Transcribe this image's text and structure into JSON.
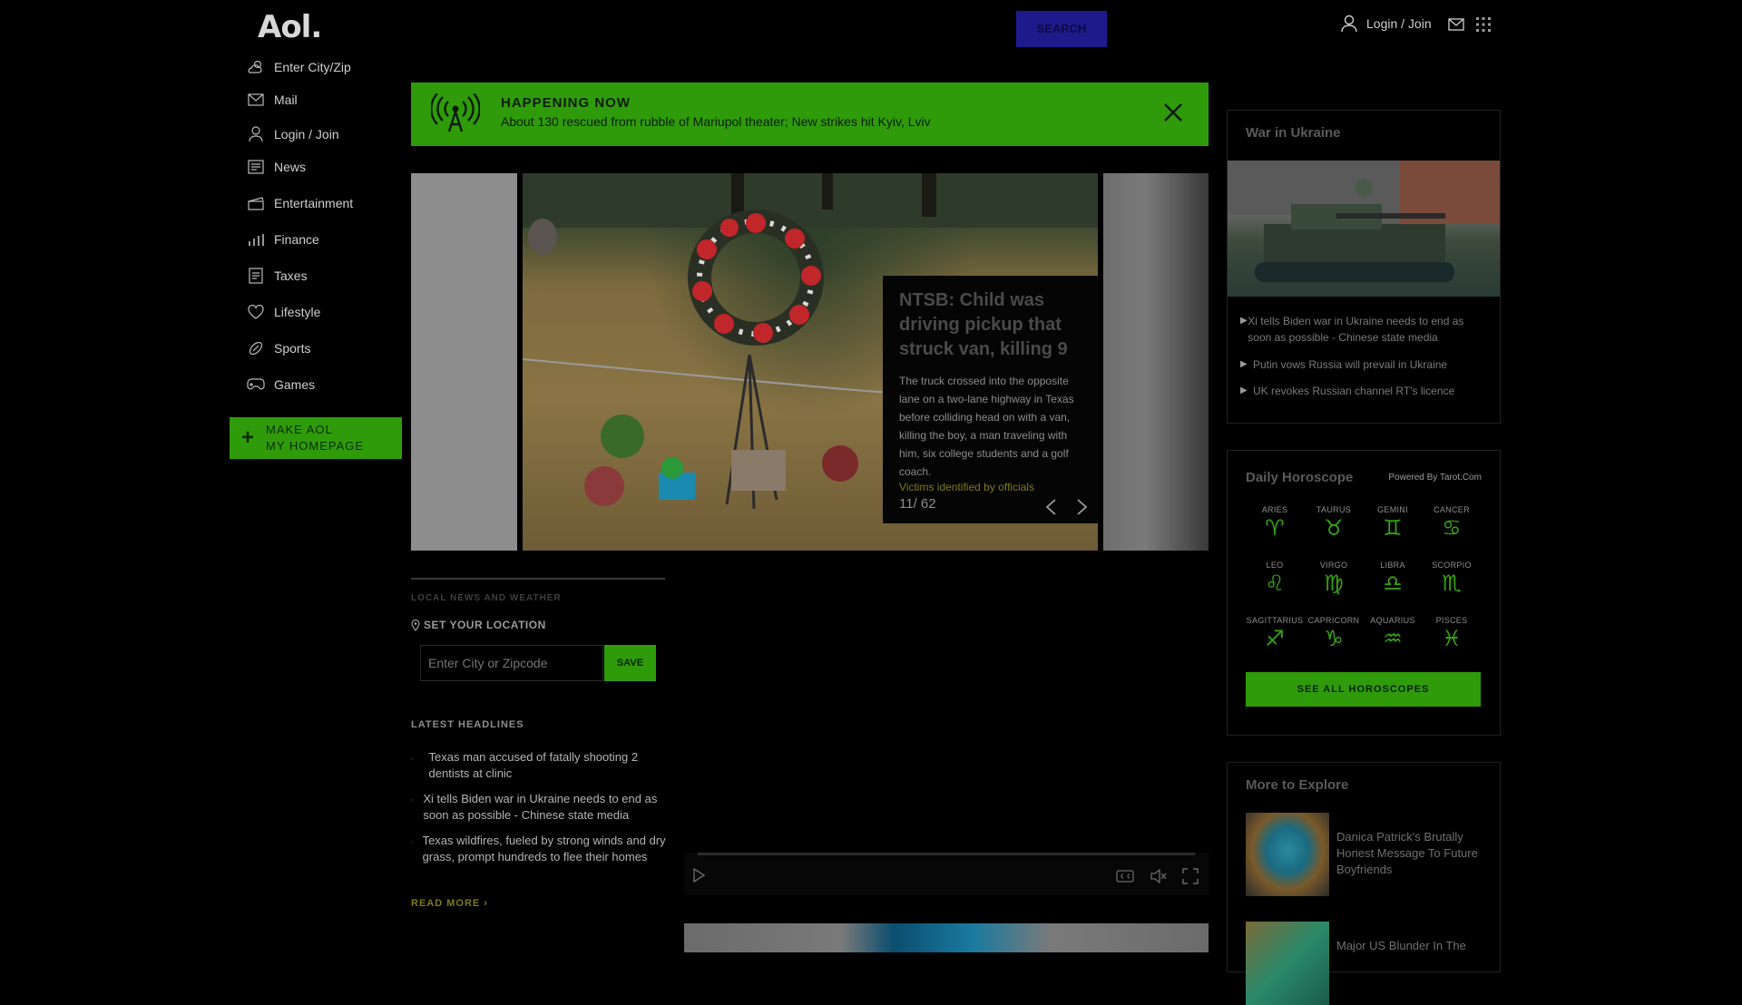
{
  "header": {
    "logo": "Aol.",
    "search_label": "SEARCH",
    "login_label": "Login / Join"
  },
  "sidebar": {
    "items": [
      {
        "label": "Enter City/Zip",
        "icon": "weather-icon"
      },
      {
        "label": "Mail",
        "icon": "mail-icon"
      },
      {
        "label": "Login / Join",
        "icon": "user-icon"
      },
      {
        "label": "News",
        "icon": "news-icon"
      },
      {
        "label": "Entertainment",
        "icon": "clapper-icon"
      },
      {
        "label": "Finance",
        "icon": "chart-icon"
      },
      {
        "label": "Taxes",
        "icon": "taxes-icon"
      },
      {
        "label": "Lifestyle",
        "icon": "heart-icon"
      },
      {
        "label": "Sports",
        "icon": "football-icon"
      },
      {
        "label": "Games",
        "icon": "gamepad-icon"
      }
    ],
    "make_home_line1": "MAKE AOL",
    "make_home_line2": "MY HOMEPAGE"
  },
  "happening": {
    "title": "HAPPENING NOW",
    "text": "About 130 rescued from rubble of Mariupol theater; New strikes hit Kyiv, Lviv"
  },
  "carousel": {
    "headline": "NTSB: Child was driving pickup that struck van, killing 9",
    "body": "The truck crossed into the opposite lane on a two-lane highway in Texas before colliding head on with a van, killing the boy, a man traveling with him, six college students and a golf coach.",
    "link": "Victims identified by officials",
    "counter": "11/ 62"
  },
  "local": {
    "title": "LOCAL NEWS AND WEATHER",
    "set_location": "SET YOUR LOCATION",
    "input_placeholder": "Enter City or Zipcode",
    "save_label": "SAVE"
  },
  "latest": {
    "title": "LATEST HEADLINES",
    "items": [
      "Texas man accused of fatally shooting 2 dentists at clinic",
      "Xi tells Biden war in Ukraine needs to end as soon as possible - Chinese state media",
      "Texas wildfires, fueled by strong winds and dry grass, prompt hundreds to flee their homes"
    ],
    "read_more": "READ MORE ›"
  },
  "ukraine": {
    "title": "War in Ukraine",
    "items": [
      "Xi tells Biden war in Ukraine needs to end as soon as possible - Chinese state media",
      "Putin vows Russia will prevail in Ukraine",
      "UK revokes Russian channel RT's licence"
    ]
  },
  "horoscope": {
    "title": "Daily Horoscope",
    "powered": "Powered By Tarot.Com",
    "signs": [
      {
        "name": "ARIES",
        "glyph": "♈"
      },
      {
        "name": "TAURUS",
        "glyph": "♉"
      },
      {
        "name": "GEMINI",
        "glyph": "♊"
      },
      {
        "name": "CANCER",
        "glyph": "♋"
      },
      {
        "name": "LEO",
        "glyph": "♌"
      },
      {
        "name": "VIRGO",
        "glyph": "♍"
      },
      {
        "name": "LIBRA",
        "glyph": "♎"
      },
      {
        "name": "SCORPIO",
        "glyph": "♏"
      },
      {
        "name": "SAGITTARIUS",
        "glyph": "♐"
      },
      {
        "name": "CAPRICORN",
        "glyph": "♑"
      },
      {
        "name": "AQUARIUS",
        "glyph": "♒"
      },
      {
        "name": "PISCES",
        "glyph": "♓"
      }
    ],
    "button": "SEE ALL HOROSCOPES"
  },
  "explore": {
    "title": "More to Explore",
    "items": [
      "Danica Patrick's Brutally Honest Message To Future Boyfriends",
      "Major US Blunder In The"
    ]
  },
  "colors": {
    "accent_green": "#2f9b0a",
    "search_blue": "#1f1a8c",
    "background": "#000000"
  }
}
